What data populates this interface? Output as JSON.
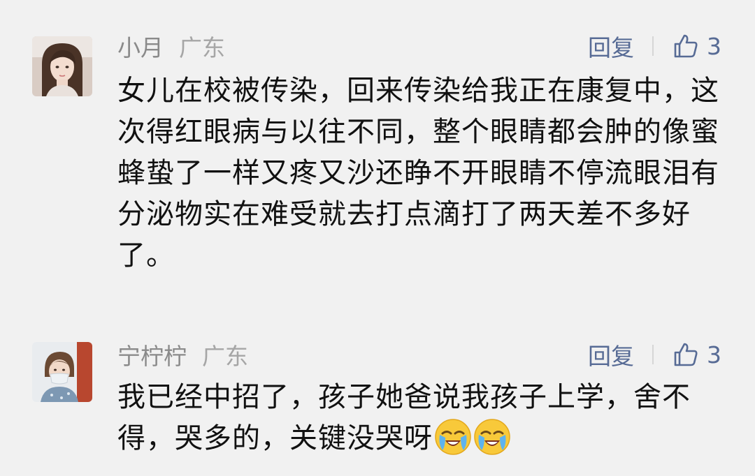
{
  "comments": [
    {
      "avatar_icon": "avatar-young-woman",
      "username": "小月",
      "region": "广东",
      "reply_label": "回复",
      "like_icon": "thumbs-up-outline-icon",
      "like_count": "3",
      "text": "女儿在校被传染，回来传染给我正在康复中，这次得红眼病与以往不同，整个眼睛都会肿的像蜜蜂蛰了一样又疼又沙还睁不开眼睛不停流眼泪有分泌物实在难受就去打点滴打了两天差不多好了。"
    },
    {
      "avatar_icon": "avatar-child-with-mask",
      "username": "宁柠柠",
      "region": "广东",
      "reply_label": "回复",
      "like_icon": "thumbs-up-outline-icon",
      "like_count": "3",
      "text": "我已经中招了，孩子她爸说我孩子上学，舍不得，哭多的，关键没哭呀",
      "trailing_emojis": [
        "loudly-crying-face-emoji",
        "loudly-crying-face-emoji"
      ]
    }
  ],
  "colors": {
    "background": "#f1f1f1",
    "meta_gray": "#8a8a8a",
    "link_blue": "#576b95",
    "body_text": "#111111"
  }
}
